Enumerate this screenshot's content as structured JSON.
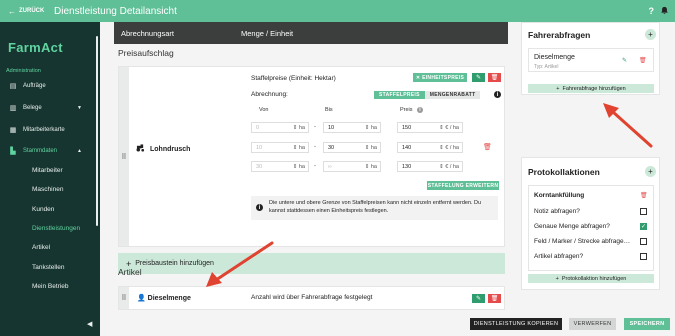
{
  "topbar": {
    "back_label": "ZURÜCK",
    "title": "Dienstleistung Detailansicht",
    "help_icon": "?",
    "bell_icon": "bell-icon"
  },
  "sidebar": {
    "logo": "FarmAct",
    "section": "Administration",
    "items": [
      {
        "label": "Aufträge",
        "icon": "clipboard-icon"
      },
      {
        "label": "Belege",
        "icon": "document-icon"
      },
      {
        "label": "Mitarbeiterkarte",
        "icon": "map-icon"
      },
      {
        "label": "Stammdaten",
        "icon": "chart-icon"
      }
    ],
    "subitems": [
      "Mitarbeiter",
      "Maschinen",
      "Kunden",
      "Dienstleistungen",
      "Artikel",
      "Tankstellen",
      "Mein Betrieb"
    ]
  },
  "table_header": {
    "col1": "Abrechnungsart",
    "col2": "Menge / Einheit"
  },
  "preis": {
    "heading": "Preisaufschlag",
    "service_name": "Lohndrusch",
    "staffel_title": "Staffelpreise (Einheit: Hektar)",
    "einheitspreis_label": "EINHEITSPREIS",
    "abrechnung_label": "Abrechnung:",
    "toggle_on": "STAFFELPREIS",
    "toggle_off": "MENGENRABATT",
    "col_von": "Von",
    "col_bis": "Bis",
    "col_preis": "Preis",
    "rows": [
      {
        "von": "0",
        "bis": "10",
        "preis": "150"
      },
      {
        "von": "10",
        "bis": "30",
        "preis": "140"
      },
      {
        "von": "30",
        "bis": "∞",
        "preis": "130"
      }
    ],
    "unit_ha": "ha",
    "unit_eur": "€ / ha",
    "dash": "-",
    "erweitern_label": "STAFFELUNG ERWEITERN",
    "note": "Die untere und obere Grenze von Staffelpreisen kann nicht einzeln entfernt werden. Du kannst stattdessen einen Einheitspreis festlegen.",
    "add_label": "Preisbaustein hinzufügen"
  },
  "artikel": {
    "heading": "Artikel",
    "item_name": "Dieselmenge",
    "item_desc": "Anzahl wird über Fahrerabfrage festgelegt"
  },
  "fahrerabfragen": {
    "title": "Fahrerabfragen",
    "item_name": "Dieselmenge",
    "item_type": "Typ: Artikel",
    "add_label": "Fahrerabfrage hinzufügen"
  },
  "protokoll": {
    "title": "Protokollaktionen",
    "item_name": "Korntankfüllung",
    "checks": [
      {
        "label": "Notiz abfragen?",
        "checked": false
      },
      {
        "label": "Genaue Menge abfragen?",
        "checked": true
      },
      {
        "label": "Feld / Marker / Strecke abfrage…",
        "checked": false
      },
      {
        "label": "Artikel abfragen?",
        "checked": false
      }
    ],
    "add_label": "Protokollaktion hinzufügen"
  },
  "footer": {
    "copy": "DIENSTLEISTUNG KOPIEREN",
    "discard": "VERWERFEN",
    "save": "SPEICHERN"
  },
  "colors": {
    "accent": "#5fbf97",
    "sidebar": "#173530",
    "danger": "#e54b4b",
    "arrow": "#e0432f"
  }
}
